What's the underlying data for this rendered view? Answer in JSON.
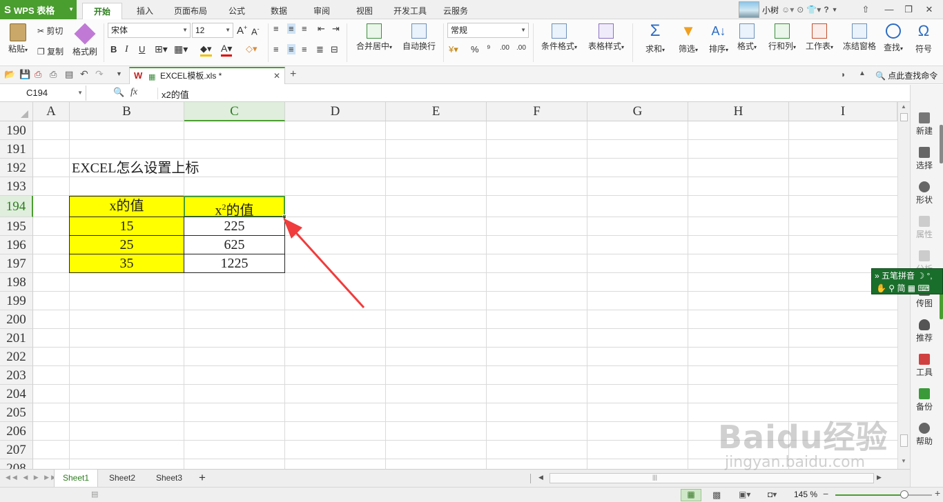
{
  "app": {
    "name": "WPS 表格"
  },
  "menu": {
    "tabs": [
      "开始",
      "插入",
      "页面布局",
      "公式",
      "数据",
      "审阅",
      "视图",
      "开发工具",
      "云服务"
    ],
    "active": "开始"
  },
  "user": {
    "name": "小树",
    "help": "?"
  },
  "ribbon": {
    "paste": "粘贴",
    "cut": "剪切",
    "copy": "复制",
    "format_painter": "格式刷",
    "font_name": "宋体",
    "font_size": "12",
    "bold": "B",
    "italic": "I",
    "underline": "U",
    "merge_center": "合并居中",
    "wrap_text": "自动换行",
    "number_format": "常规",
    "percent": "%",
    "comma": "⁹",
    "dec_inc": ".00",
    "dec_dec": ".00",
    "conditional_format": "条件格式",
    "table_style": "表格样式",
    "sum": "求和",
    "filter": "筛选",
    "sort": "排序",
    "format": "格式",
    "rows_cols": "行和列",
    "worksheet": "工作表",
    "freeze": "冻结窗格",
    "find": "查找",
    "symbol": "符号"
  },
  "quickbar": {
    "doc_tab": "EXCEL模板.xls *",
    "search_cmd": "点此查找命令"
  },
  "formula_bar": {
    "name_box": "C194",
    "fx": "fx",
    "content": "x2的值"
  },
  "grid": {
    "columns": [
      "A",
      "B",
      "C",
      "D",
      "E",
      "F",
      "G",
      "H",
      "I"
    ],
    "selected_column": "C",
    "rows": [
      "190",
      "191",
      "192",
      "193",
      "194",
      "195",
      "196",
      "197",
      "198",
      "199",
      "200",
      "201",
      "202",
      "203",
      "204",
      "205",
      "206",
      "207",
      "208"
    ],
    "selected_row": "194",
    "title_cell": "EXCEL怎么设置上标",
    "table": {
      "header_b": "x的值",
      "header_c_base": "x",
      "header_c_sup": "2",
      "header_c_rest": "的值",
      "rows": [
        [
          "15",
          "225"
        ],
        [
          "25",
          "625"
        ],
        [
          "35",
          "1225"
        ]
      ]
    }
  },
  "right_panel": [
    "新建",
    "选择",
    "形状",
    "属性",
    "分析",
    "传图",
    "推荐",
    "工具",
    "备份",
    "帮助"
  ],
  "ime": {
    "line1": "五笔拼音",
    "line2": "简"
  },
  "sheets": {
    "tabs": [
      "Sheet1",
      "Sheet2",
      "Sheet3"
    ],
    "active": "Sheet1",
    "add": "+"
  },
  "status": {
    "zoom": "145 %"
  },
  "watermark": {
    "brand": "Baidu经验",
    "url": "jingyan.baidu.com"
  },
  "colors": {
    "accent": "#4a9d2f",
    "highlight": "#ffff00",
    "arrow": "#f03c3c"
  }
}
